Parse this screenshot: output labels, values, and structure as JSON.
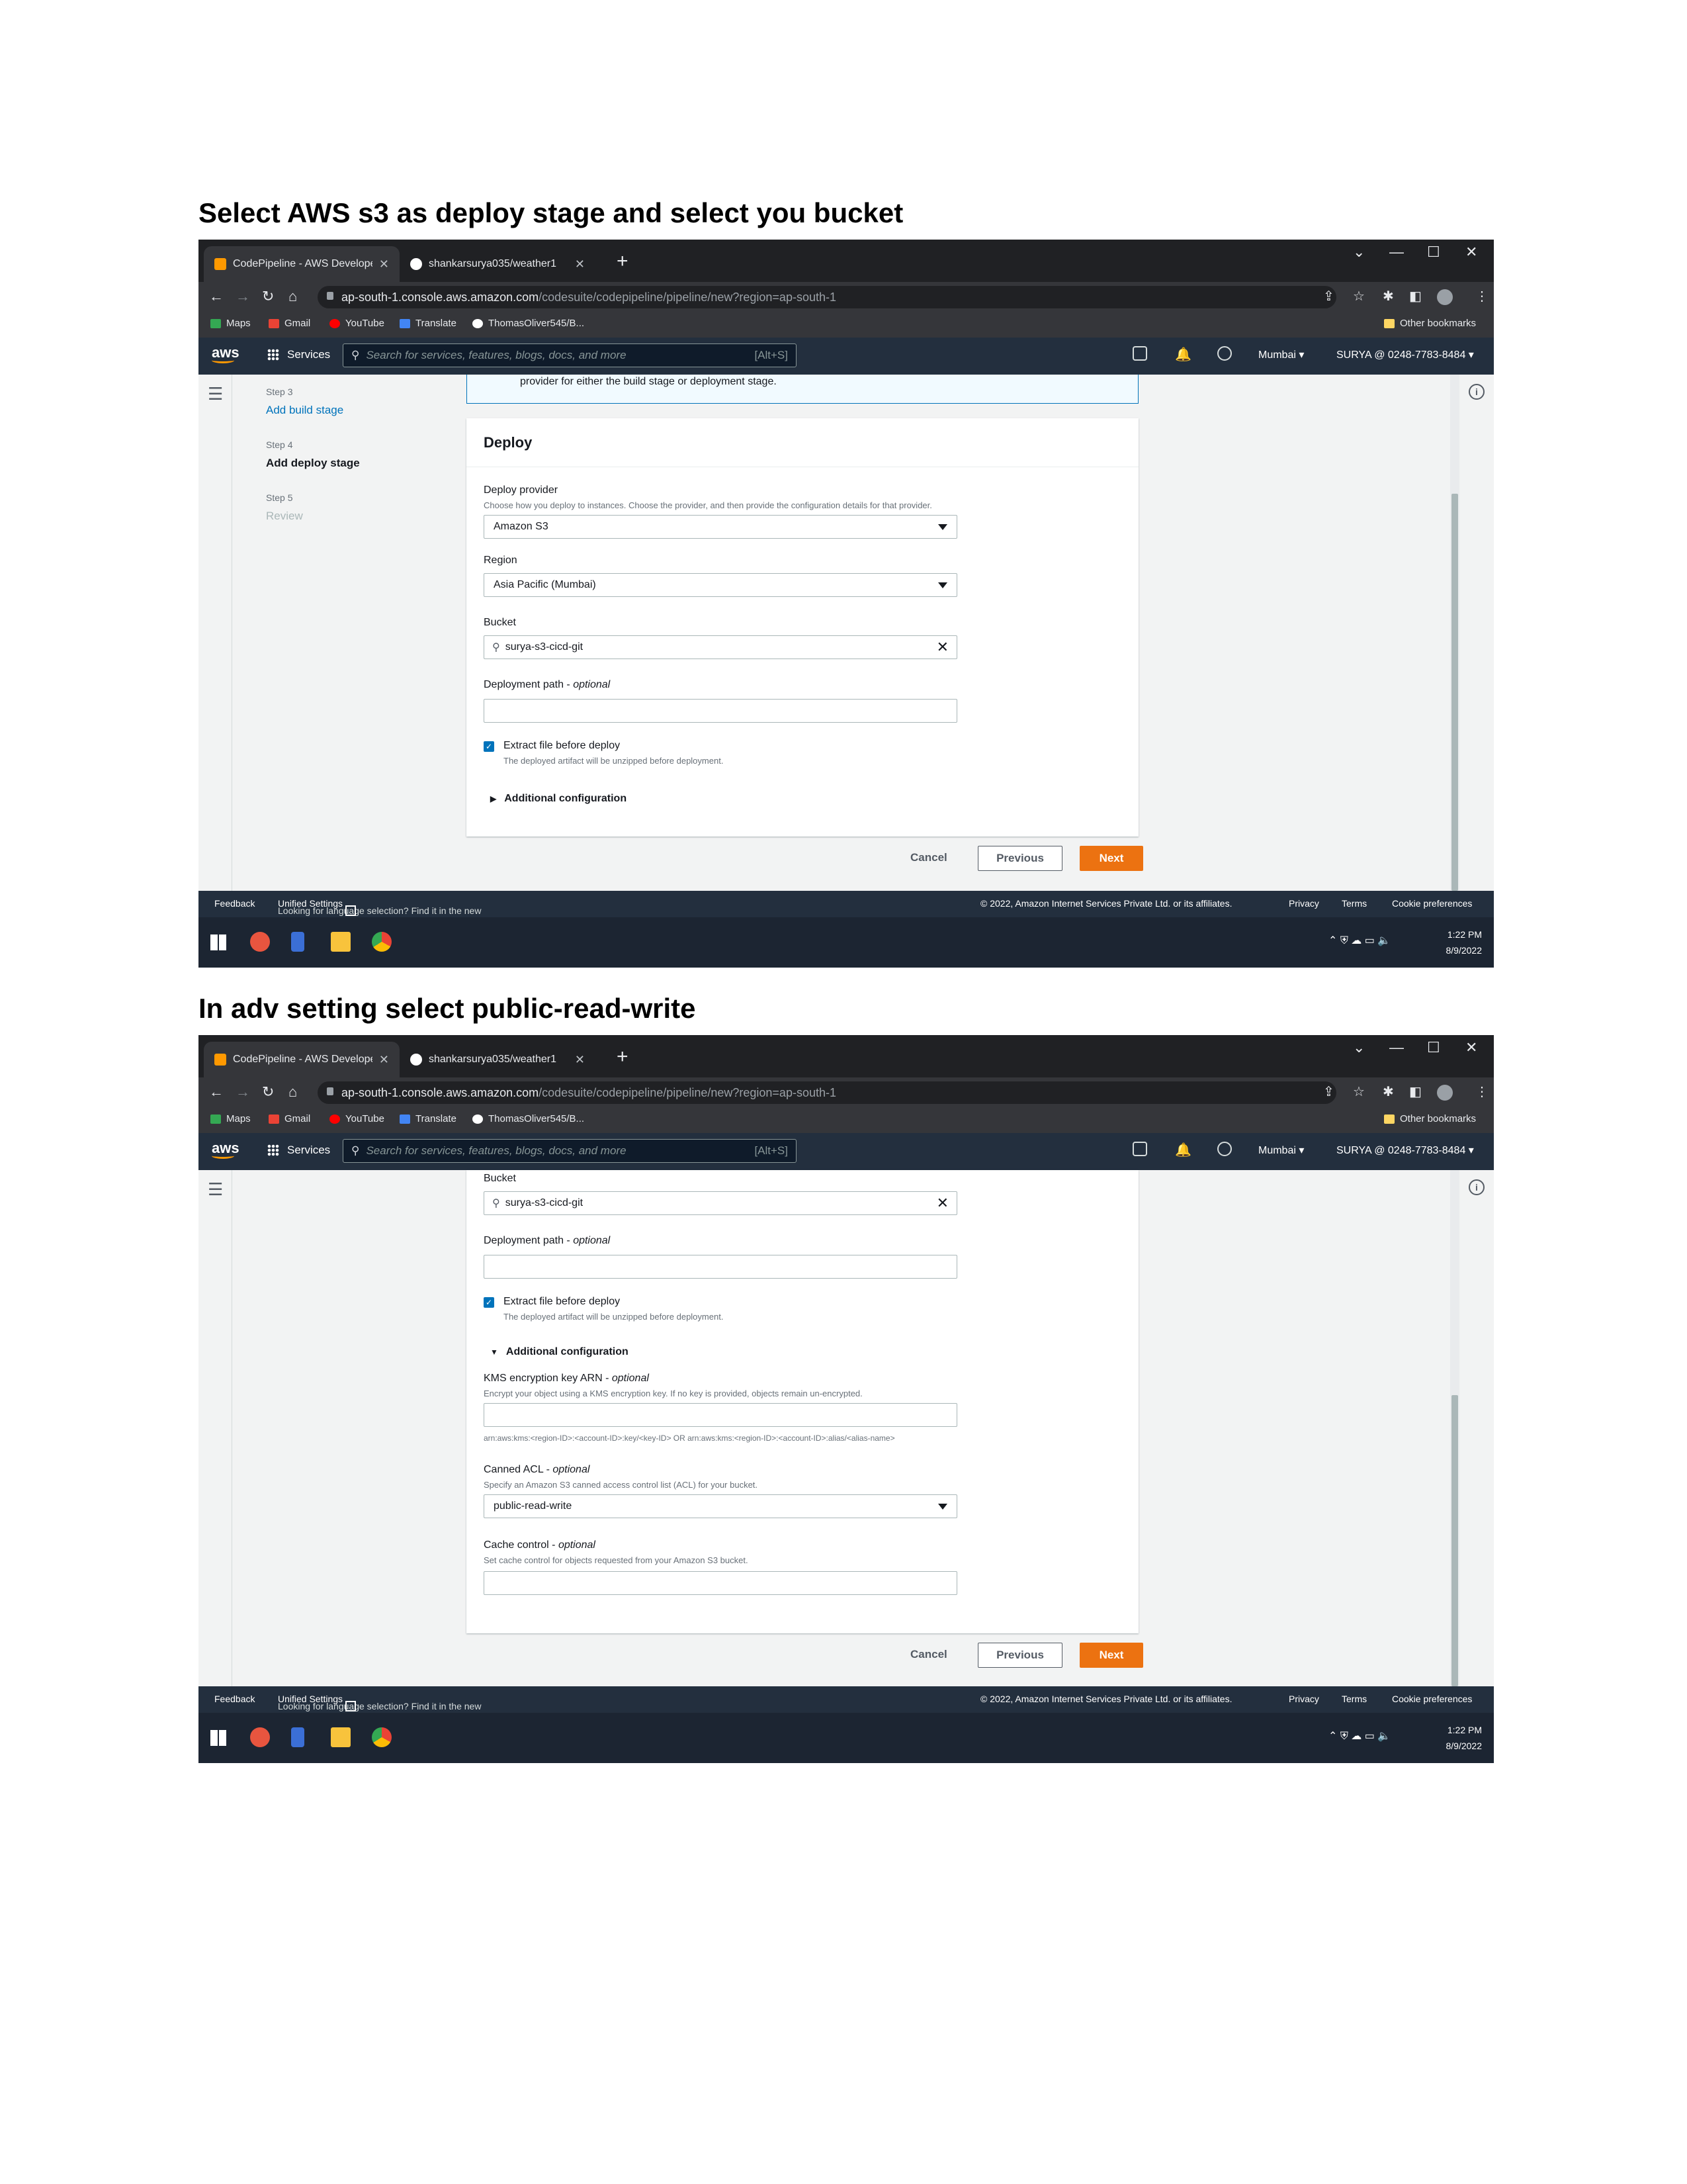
{
  "headings": {
    "first": "Select AWS s3 as deploy stage and select you bucket",
    "second": "In adv setting select public-read-write"
  },
  "browser": {
    "tabs": [
      "CodePipeline - AWS Developer T",
      "shankarsurya035/weather1"
    ],
    "url_host": "ap-south-1.console.aws.amazon.com",
    "url_path": "/codesuite/codepipeline/pipeline/new?region=ap-south-1",
    "bookmarks": [
      "Maps",
      "Gmail",
      "YouTube",
      "Translate",
      "ThomasOliver545/B..."
    ],
    "other_bookmarks": "Other bookmarks"
  },
  "aws_nav": {
    "logo": "aws",
    "services": "Services",
    "search_placeholder": "Search for services, features, blogs, docs, and more",
    "search_shortcut": "[Alt+S]",
    "region": "Mumbai",
    "account": "SURYA @ 0248-7783-8484"
  },
  "steps": [
    {
      "num": "Step 3",
      "title": "Add build stage"
    },
    {
      "num": "Step 4",
      "title": "Add deploy stage"
    },
    {
      "num": "Step 5",
      "title": "Review"
    }
  ],
  "banner_text": "provider for either the build stage or deployment stage.",
  "deploy": {
    "title": "Deploy",
    "provider_label": "Deploy provider",
    "provider_desc": "Choose how you deploy to instances. Choose the provider, and then provide the configuration details for that provider.",
    "provider_value": "Amazon S3",
    "region_label": "Region",
    "region_value": "Asia Pacific (Mumbai)",
    "bucket_label": "Bucket",
    "bucket_value": "surya-s3-cicd-git",
    "path_label": "Deployment path - ",
    "path_optional": "optional",
    "extract_label": "Extract file before deploy",
    "extract_desc": "The deployed artifact will be unzipped before deployment.",
    "additional": "Additional configuration",
    "kms_label": "KMS encryption key ARN - ",
    "kms_optional": "optional",
    "kms_desc": "Encrypt your object using a KMS encryption key. If no key is provided, objects remain un-encrypted.",
    "kms_hint": "arn:aws:kms:<region-ID>:<account-ID>:key/<key-ID> OR arn:aws:kms:<region-ID>:<account-ID>:alias/<alias-name>",
    "acl_label": "Canned ACL - ",
    "acl_optional": "optional",
    "acl_desc": "Specify an Amazon S3 canned access control list (ACL) for your bucket.",
    "acl_value": "public-read-write",
    "cache_label": "Cache control - ",
    "cache_optional": "optional",
    "cache_desc": "Set cache control for objects requested from your Amazon S3 bucket."
  },
  "actions": {
    "cancel": "Cancel",
    "previous": "Previous",
    "next": "Next"
  },
  "footer": {
    "feedback": "Feedback",
    "lang_text": "Looking for language selection? Find it in the new",
    "unified": "Unified Settings",
    "copyright": "© 2022, Amazon Internet Services Private Ltd. or its affiliates.",
    "privacy": "Privacy",
    "terms": "Terms",
    "cookie": "Cookie preferences"
  },
  "taskbar": {
    "time": "1:22 PM",
    "date": "8/9/2022"
  }
}
